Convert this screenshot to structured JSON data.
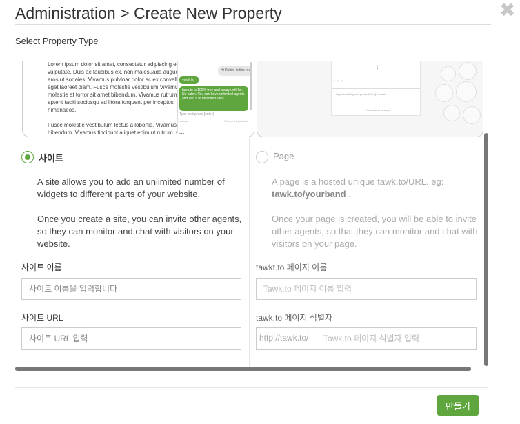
{
  "header": {
    "title": "Administration > Create New Property",
    "close_label": "✖"
  },
  "subtitle": "Select Property Type",
  "preview": {
    "site": {
      "lorem_1": "Lorem ipsum dolor sit amet, consectetur adipiscing elit. sed vulputate. Duis ac faucibus ex, non malesuada augue suscipit eros ut sodales. Vivamus pulvinar dolor ac ex convallis orci, eget laoreet diam. Fusce molestie vestibulum Vivamus molestie at tortor sit amet bibendum. Vivamus rutrum. Class aptent taciti sociosqu ad litora torquent per inceptos himenaeos.",
      "lorem_2": "Fusce molestie vestibulum lectus a lobortis. Vivamus m bibendum. Vivamus tincidunt aliquet enim ut rutrum. Cla",
      "chat_visitor": "Hi Robin, is this really free?",
      "chat_agent_1": "yes it is",
      "chat_agent_2": "tawk.to is 100% free and always will be. No catch. You can have unlimited agents and add it to unlimited sites.",
      "chat_input": "Type and press [enter]",
      "chat_footer_left": "options",
      "chat_footer_right": "Powered by tawk.to"
    },
    "page": {
      "arrow": "↓",
      "dots": "○ ○ ○",
      "input_placeholder": "Say something and press [Enter] to chat...",
      "footer": "© 2014 tawk.to. All Rights"
    }
  },
  "types": {
    "site": {
      "label": "사이트",
      "selected": true,
      "desc_1": "A site allows you to add an unlimited number of widgets to different parts of your website.",
      "desc_2": "Once you create a site, you can invite other agents, so they can monitor and chat with visitors on your website."
    },
    "page": {
      "label": "Page",
      "selected": false,
      "desc_1_pre": "A page is a hosted unique tawk.to/URL. eg:",
      "desc_1_bold": "tawk.to/yourband",
      "desc_1_post": ".",
      "desc_2": "Once your page is created, you will be able to invite other agents, so that they can monitor and chat with visitors on your page."
    }
  },
  "fields": {
    "site_name": {
      "label": "사이트 이름",
      "placeholder": "사이트 이름을 입력합니다"
    },
    "site_url": {
      "label": "사이트 URL",
      "placeholder": "사이트 URL 입력"
    },
    "page_name": {
      "label": "tawkt.to 페이지 이름",
      "placeholder": "Tawk.to 페이지 이름 입력"
    },
    "page_id": {
      "label": "tawk.to 페이지 식별자",
      "prefix": "http://tawk.to/",
      "placeholder": "Tawk.to 페이지 식별자 입력"
    }
  },
  "create_button": "만들기",
  "colors": {
    "accent": "#5ea63d",
    "scrollbar": "#777777",
    "close_icon": "#c7c7c7"
  }
}
